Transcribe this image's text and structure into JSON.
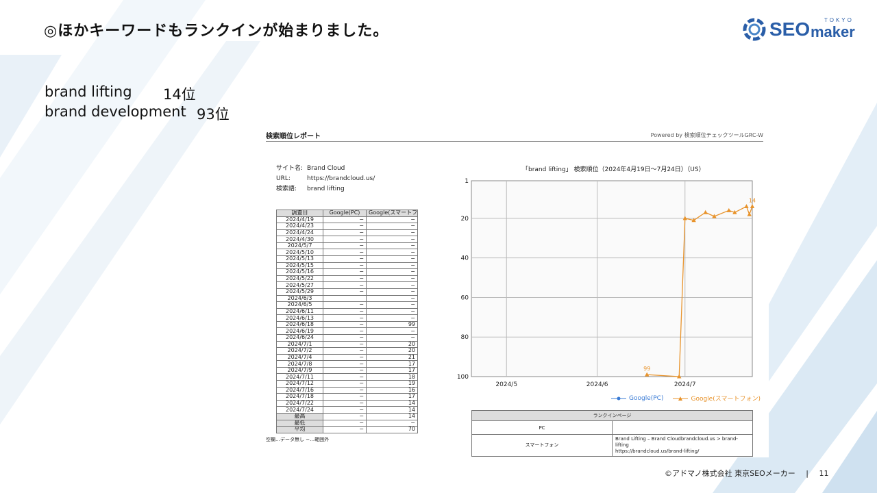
{
  "slide": {
    "title": "◎ほかキーワードもランクインが始まりました。",
    "logo": {
      "text_seo": "SEO",
      "text_maker": "maker",
      "text_tokyo": "TOKYO"
    },
    "keywords": [
      {
        "name": "brand lifting",
        "rank": "14位"
      },
      {
        "name": "brand development",
        "rank": "93位"
      }
    ],
    "footer": {
      "copyright": "©アドマノ株式会社 東京SEOメーカー",
      "separator": "|",
      "page": "11"
    }
  },
  "report": {
    "title": "検索順位レポート",
    "powered_by": "Powered by 検索順位チェックツールGRC-W",
    "site_info": [
      {
        "label": "サイト名:",
        "value": "Brand Cloud"
      },
      {
        "label": "URL:",
        "value": "https://brandcloud.us/"
      },
      {
        "label": "検索語:",
        "value": "brand lifting"
      }
    ],
    "table": {
      "headers": [
        "調査日",
        "Google(PC)",
        "Google(スマートフォン)"
      ],
      "rows": [
        [
          "2024/4/19",
          "−",
          "−"
        ],
        [
          "2024/4/23",
          "−",
          "−"
        ],
        [
          "2024/4/24",
          "−",
          "−"
        ],
        [
          "2024/4/30",
          "−",
          "−"
        ],
        [
          "2024/5/7",
          "−",
          "−"
        ],
        [
          "2024/5/10",
          "−",
          "−"
        ],
        [
          "2024/5/13",
          "−",
          "−"
        ],
        [
          "2024/5/15",
          "−",
          "−"
        ],
        [
          "2024/5/16",
          "−",
          "−"
        ],
        [
          "2024/5/22",
          "−",
          "−"
        ],
        [
          "2024/5/27",
          "−",
          "−"
        ],
        [
          "2024/5/29",
          "−",
          "−"
        ],
        [
          "2024/6/3",
          "",
          "−"
        ],
        [
          "2024/6/5",
          "−",
          "−"
        ],
        [
          "2024/6/11",
          "−",
          "−"
        ],
        [
          "2024/6/13",
          "−",
          "−"
        ],
        [
          "2024/6/18",
          "−",
          "99"
        ],
        [
          "2024/6/19",
          "−",
          "−"
        ],
        [
          "2024/6/24",
          "−",
          "−"
        ],
        [
          "2024/7/1",
          "−",
          "20"
        ],
        [
          "2024/7/2",
          "−",
          "20"
        ],
        [
          "2024/7/4",
          "−",
          "21"
        ],
        [
          "2024/7/8",
          "−",
          "17"
        ],
        [
          "2024/7/9",
          "−",
          "17"
        ],
        [
          "2024/7/11",
          "−",
          "18"
        ],
        [
          "2024/7/12",
          "−",
          "19"
        ],
        [
          "2024/7/16",
          "−",
          "16"
        ],
        [
          "2024/7/18",
          "−",
          "17"
        ],
        [
          "2024/7/22",
          "−",
          "14"
        ],
        [
          "2024/7/24",
          "−",
          "14"
        ]
      ],
      "summary": [
        [
          "最高",
          "−",
          "14"
        ],
        [
          "最低",
          "−",
          "−"
        ],
        [
          "平均",
          "−",
          "70"
        ]
      ],
      "note": "空欄…データ無し −…範囲外"
    },
    "landing": {
      "header": "ランクインページ",
      "rows": [
        {
          "label": "PC",
          "line1": "",
          "line2": ""
        },
        {
          "label": "スマートフォン",
          "line1": "Brand Lifting – Brand Cloudbrandcloud.us > brand-lifting",
          "line2": "https://brandcloud.us/brand-lifting/"
        }
      ]
    }
  },
  "chart_data": {
    "type": "line",
    "title": "「brand lifting」 検索順位（2024年4月19日～7月24日）（US）",
    "xlabel": "",
    "ylabel": "",
    "y_axis": {
      "reversed": true,
      "ylim": [
        1,
        100
      ],
      "ticks": [
        1,
        20,
        40,
        60,
        80,
        100
      ]
    },
    "x_axis": {
      "range": [
        "2024-04-19",
        "2024-07-24"
      ],
      "ticks": [
        {
          "label": "2024/5",
          "date": "2024-05-01"
        },
        {
          "label": "2024/6",
          "date": "2024-06-01"
        },
        {
          "label": "2024/7",
          "date": "2024-07-01"
        }
      ]
    },
    "grid": true,
    "legend": "bottom-right",
    "series": [
      {
        "name": "Google(PC)",
        "color": "#3a7bd5",
        "points": []
      },
      {
        "name": "Google(スマートフォン)",
        "color": "#e8932b",
        "points": [
          {
            "date": "2024-06-18",
            "rank": 99,
            "label": "99"
          },
          {
            "date": "2024-06-29",
            "rank": 100
          },
          {
            "date": "2024-07-01",
            "rank": 20
          },
          {
            "date": "2024-07-04",
            "rank": 21
          },
          {
            "date": "2024-07-08",
            "rank": 17
          },
          {
            "date": "2024-07-11",
            "rank": 19
          },
          {
            "date": "2024-07-16",
            "rank": 16
          },
          {
            "date": "2024-07-18",
            "rank": 17
          },
          {
            "date": "2024-07-22",
            "rank": 14
          },
          {
            "date": "2024-07-23",
            "rank": 18
          },
          {
            "date": "2024-07-24",
            "rank": 14,
            "label": "14"
          }
        ]
      }
    ]
  }
}
